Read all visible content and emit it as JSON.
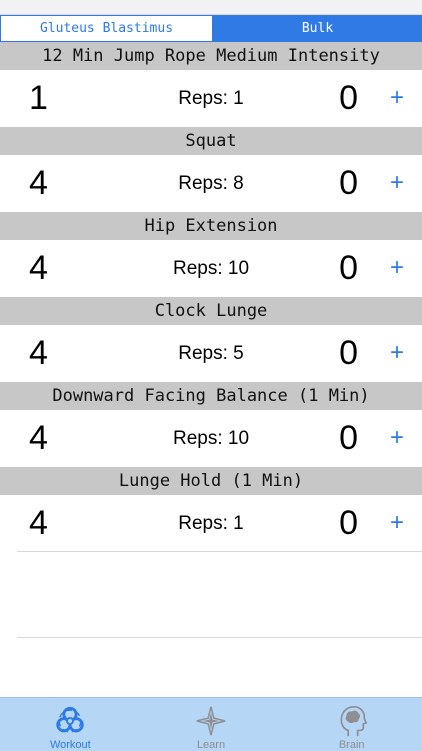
{
  "segments": {
    "left": "Gluteus Blastimus",
    "right": "Bulk"
  },
  "exercises": [
    {
      "name": "12 Min Jump Rope Medium Intensity",
      "sets": "1",
      "reps": "Reps: 1",
      "count": "0",
      "add": "+"
    },
    {
      "name": "Squat",
      "sets": "4",
      "reps": "Reps: 8",
      "count": "0",
      "add": "+"
    },
    {
      "name": "Hip Extension",
      "sets": "4",
      "reps": "Reps: 10",
      "count": "0",
      "add": "+"
    },
    {
      "name": "Clock Lunge",
      "sets": "4",
      "reps": "Reps: 5",
      "count": "0",
      "add": "+"
    },
    {
      "name": "Downward Facing Balance (1 Min)",
      "sets": "4",
      "reps": "Reps: 10",
      "count": "0",
      "add": "+"
    },
    {
      "name": "Lunge Hold (1 Min)",
      "sets": "4",
      "reps": "Reps: 1",
      "count": "0",
      "add": "+"
    }
  ],
  "tabs": [
    {
      "label": "Workout",
      "icon": "biohazard-icon",
      "selected": true
    },
    {
      "label": "Learn",
      "icon": "compass-star-icon",
      "selected": false
    },
    {
      "label": "Brain",
      "icon": "head-brain-icon",
      "selected": false
    }
  ],
  "colors": {
    "accent": "#2f7ae5",
    "header_bg": "#c7c7c7",
    "tabbar_bg": "#b5d6f5"
  }
}
